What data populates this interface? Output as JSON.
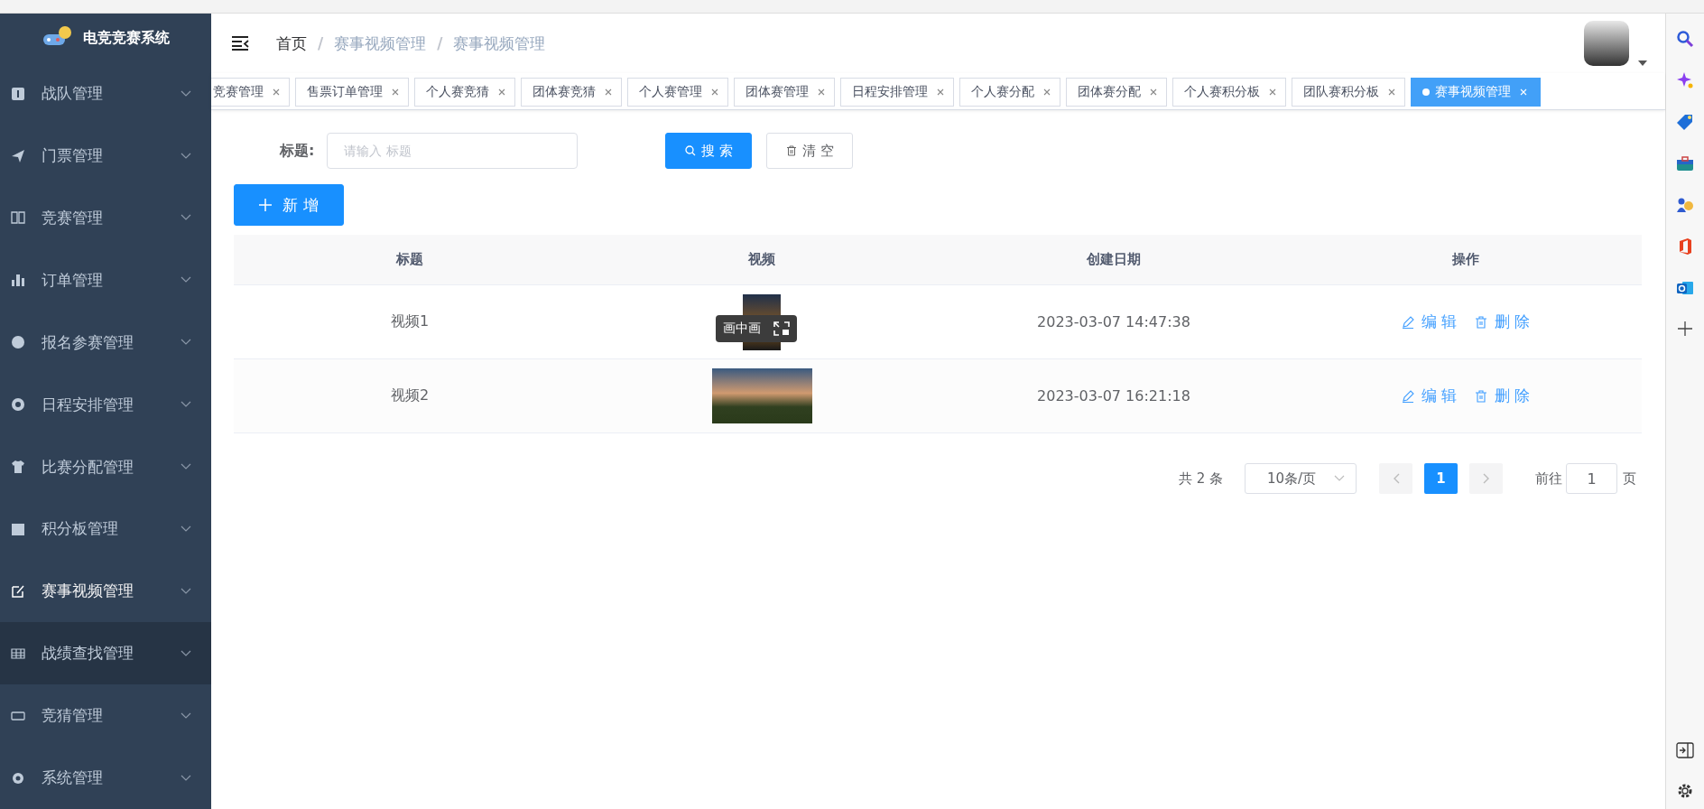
{
  "sidebar": {
    "title": "电竞竞赛系统",
    "items": [
      {
        "label": "战队管理",
        "selected": false,
        "hovered": false
      },
      {
        "label": "门票管理",
        "selected": false,
        "hovered": false
      },
      {
        "label": "竞赛管理",
        "selected": false,
        "hovered": false
      },
      {
        "label": "订单管理",
        "selected": false,
        "hovered": false
      },
      {
        "label": "报名参赛管理",
        "selected": false,
        "hovered": false
      },
      {
        "label": "日程安排管理",
        "selected": false,
        "hovered": false
      },
      {
        "label": "比赛分配管理",
        "selected": false,
        "hovered": false
      },
      {
        "label": "积分板管理",
        "selected": false,
        "hovered": false
      },
      {
        "label": "赛事视频管理",
        "selected": true,
        "hovered": false
      },
      {
        "label": "战绩查找管理",
        "selected": false,
        "hovered": true
      },
      {
        "label": "竞猜管理",
        "selected": false,
        "hovered": false
      },
      {
        "label": "系统管理",
        "selected": false,
        "hovered": false
      }
    ]
  },
  "breadcrumb": {
    "items": [
      "首页",
      "赛事视频管理",
      "赛事视频管理"
    ],
    "separators": [
      "/",
      "/"
    ]
  },
  "tabs": [
    {
      "label": "竞赛管理",
      "selected": false
    },
    {
      "label": "售票订单管理",
      "selected": false
    },
    {
      "label": "个人赛竞猜",
      "selected": false
    },
    {
      "label": "团体赛竞猜",
      "selected": false
    },
    {
      "label": "个人赛管理",
      "selected": false
    },
    {
      "label": "团体赛管理",
      "selected": false
    },
    {
      "label": "日程安排管理",
      "selected": false
    },
    {
      "label": "个人赛分配",
      "selected": false
    },
    {
      "label": "团体赛分配",
      "selected": false
    },
    {
      "label": "个人赛积分板",
      "selected": false
    },
    {
      "label": "团队赛积分板",
      "selected": false
    },
    {
      "label": "赛事视频管理",
      "selected": true
    }
  ],
  "filter": {
    "label": "标题:",
    "placeholder": "请输入 标题",
    "search_button": "搜 索",
    "clear_button": "清 空"
  },
  "add_button": "新 增",
  "table": {
    "columns": [
      "标题",
      "视频",
      "创建日期",
      "操作"
    ],
    "rows": [
      {
        "title": "视频1",
        "overlay": "画中画",
        "created": "2023-03-07 14:47:38",
        "actions": [
          "编 辑",
          "删 除"
        ]
      },
      {
        "title": "视频2",
        "created": "2023-03-07 16:21:18",
        "actions": [
          "编 辑",
          "删 除"
        ]
      }
    ]
  },
  "pagination": {
    "total": "共 2 条",
    "page_size": "10条/页",
    "pages": [
      {
        "label": "1",
        "selected": true
      }
    ],
    "goto_label": "前往",
    "goto_value": "1",
    "page_suffix": "页"
  }
}
